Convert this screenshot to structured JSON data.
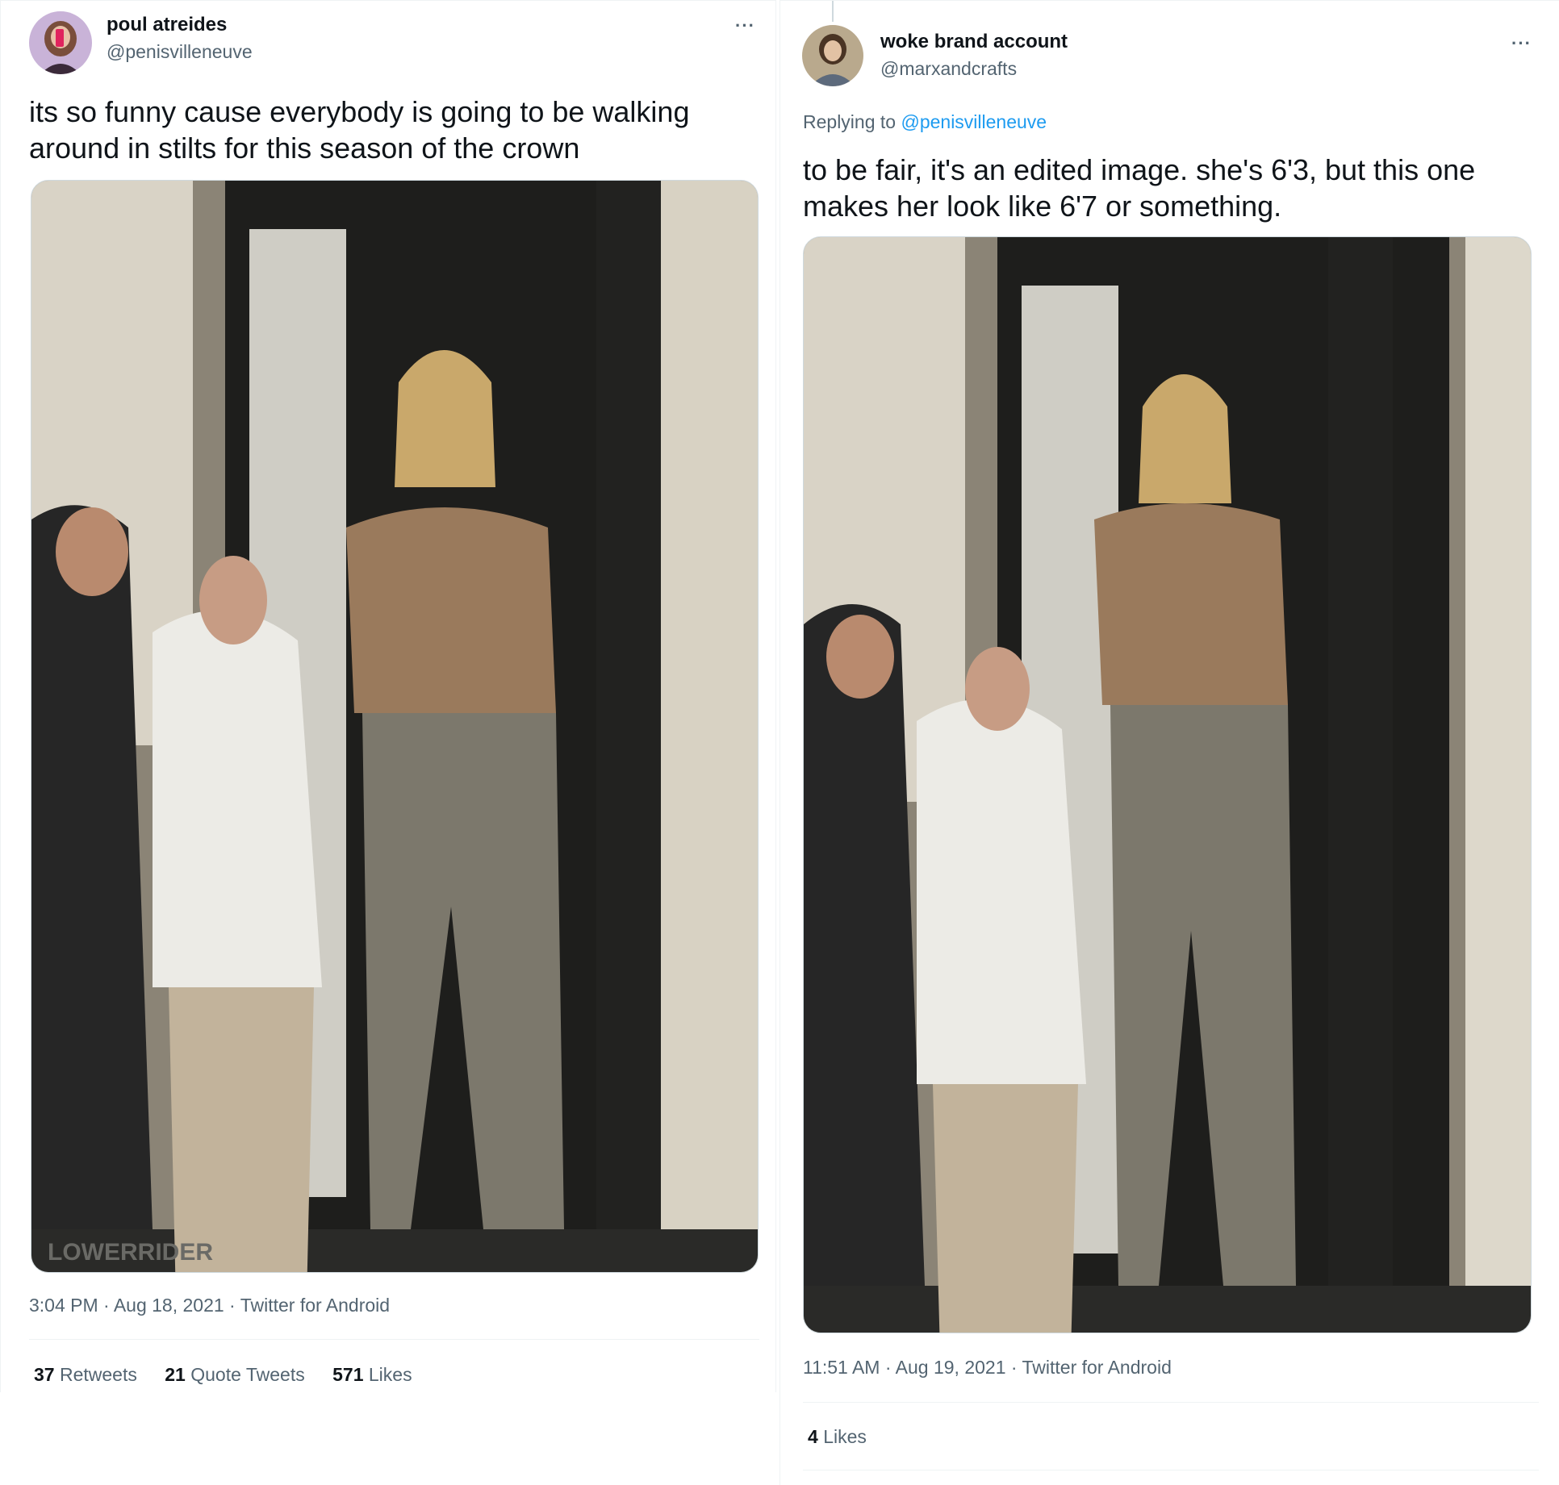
{
  "left_tweet": {
    "display_name": "poul atreides",
    "handle": "@penisvilleneuve",
    "more_label": "···",
    "text": "its so funny cause everybody is going to be walking around in stilts for this season of the crown",
    "photo_watermark": "LOWERRIDER",
    "timestamp": "3:04 PM · Aug 18, 2021 · Twitter for Android",
    "stats": {
      "retweets_count": "37",
      "retweets_label": "Retweets",
      "quotes_count": "21",
      "quotes_label": "Quote Tweets",
      "likes_count": "571",
      "likes_label": "Likes"
    }
  },
  "right_tweet": {
    "display_name": "woke brand account",
    "handle": "@marxandcrafts",
    "more_label": "···",
    "replying_prefix": "Replying to",
    "replying_handle": "@penisvilleneuve",
    "text": "to be fair, it's an edited image. she's 6'3, but this one makes her look like 6'7 or something.",
    "timestamp": "11:51 AM · Aug 19, 2021 · Twitter for Android",
    "stats": {
      "likes_count": "4",
      "likes_label": "Likes"
    }
  },
  "colors": {
    "link": "#1d9bf0",
    "secondary_text": "#536471",
    "primary_text": "#0f1419",
    "divider": "#eff3f4"
  }
}
